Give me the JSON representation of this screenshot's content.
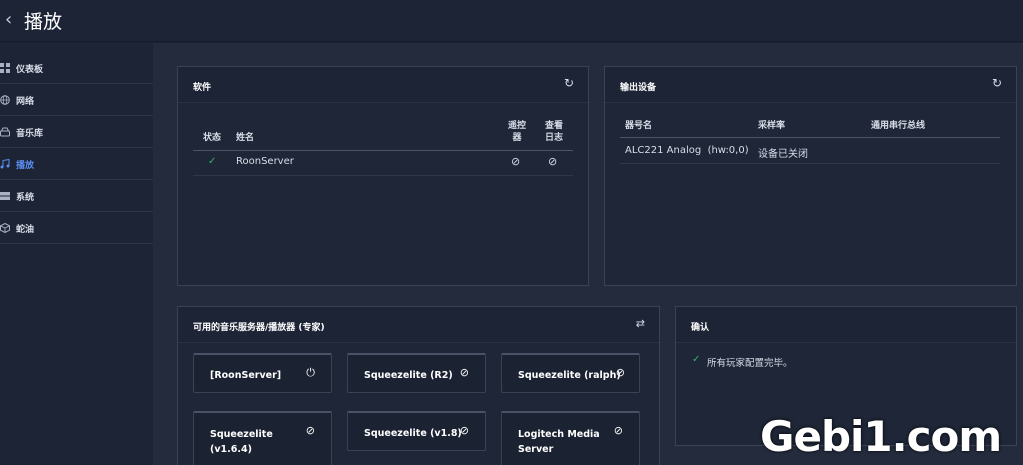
{
  "header": {
    "back_icon": "chevron-left-icon",
    "title": "播放"
  },
  "sidebar": {
    "items": [
      {
        "label": "仪表板",
        "icon": "dashboard-icon",
        "active": false
      },
      {
        "label": "网络",
        "icon": "globe-icon",
        "active": false
      },
      {
        "label": "音乐库",
        "icon": "drive-icon",
        "active": false
      },
      {
        "label": "播放",
        "icon": "music-note-icon",
        "active": true
      },
      {
        "label": "系统",
        "icon": "server-icon",
        "active": false
      },
      {
        "label": "蛇油",
        "icon": "package-icon",
        "active": false
      }
    ]
  },
  "software": {
    "title": "软件",
    "refresh_icon": "refresh-icon",
    "columns": {
      "status": "状态",
      "name": "姓名",
      "remote_l1": "遥控",
      "remote_l2": "器",
      "log_l1": "查看",
      "log_l2": "日志"
    },
    "rows": [
      {
        "status_icon": "check-icon",
        "name": "RoonServer"
      }
    ]
  },
  "output": {
    "title": "输出设备",
    "refresh_icon": "refresh-icon",
    "columns": {
      "device": "器号名",
      "rate": "采样率",
      "bus": "通用串行总线"
    },
    "rows": [
      {
        "device": "ALC221 Analog  (hw:0,0)",
        "rate": "设备已关闭",
        "bus": ""
      }
    ]
  },
  "servers": {
    "title": "可用的音乐服务器/播放器 (专家)",
    "swap_icon": "swap-icon",
    "items": [
      {
        "l1": "[RoonServer]",
        "l2": "",
        "icon": "power-icon"
      },
      {
        "l1": "Squeezelite (R2)",
        "l2": "",
        "icon": "disabled-icon"
      },
      {
        "l1": "Squeezelite (ralph)",
        "l2": "",
        "icon": "disabled-icon"
      },
      {
        "l1": "Squeezelite",
        "l2": "(v1.6.4)",
        "icon": "disabled-icon"
      },
      {
        "l1": "Squeezelite (v1.8)",
        "l2": "",
        "icon": "disabled-icon"
      },
      {
        "l1": "Logitech Media",
        "l2": "Server",
        "icon": "disabled-icon"
      }
    ]
  },
  "confirm": {
    "title": "确认",
    "message": "所有玩家配置完毕。",
    "icon": "check-icon"
  },
  "watermark": "Gebi1.com",
  "colors": {
    "accent": "#5b8def",
    "success": "#3fae6a",
    "background": "#1b2232",
    "panel": "#1e2637"
  }
}
